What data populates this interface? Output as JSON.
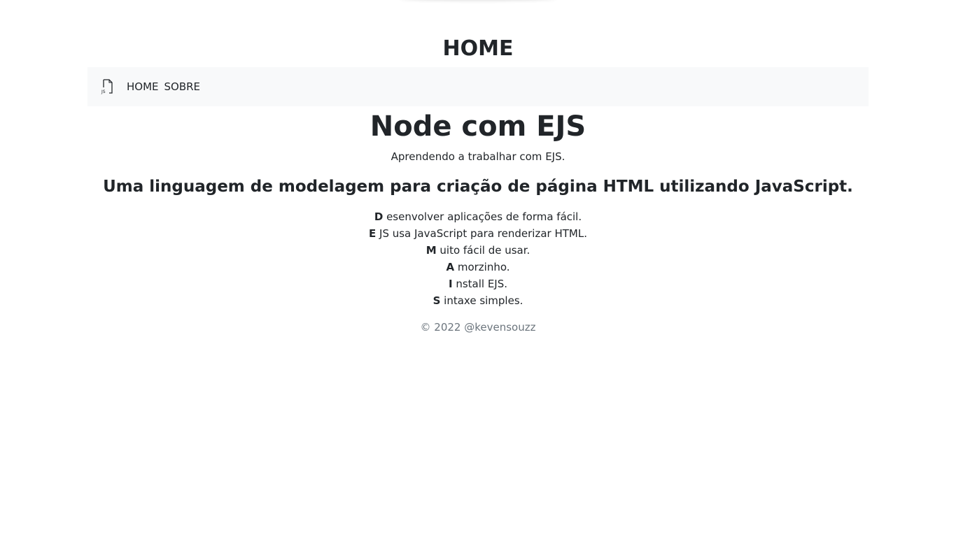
{
  "page": {
    "heading": "HOME"
  },
  "navbar": {
    "brand_icon": "ejs-file-icon",
    "links": [
      {
        "label": "HOME"
      },
      {
        "label": "SOBRE"
      }
    ]
  },
  "main": {
    "title": "Node com EJS",
    "subtitle": "Aprendendo a trabalhar com EJS.",
    "lead": "Uma linguagem de modelagem para criação de página HTML utilizando JavaScript.",
    "acrostic": [
      {
        "letter": "D",
        "rest": " esenvolver aplicações de forma fácil."
      },
      {
        "letter": "E",
        "rest": " JS usa JavaScript para renderizar HTML."
      },
      {
        "letter": "M",
        "rest": " uito fácil de usar."
      },
      {
        "letter": "A",
        "rest": " morzinho."
      },
      {
        "letter": "I",
        "rest": " nstall EJS."
      },
      {
        "letter": "S",
        "rest": " intaxe simples."
      }
    ]
  },
  "footer": {
    "text": "© 2022 @kevensouzz"
  },
  "colors": {
    "text": "#212529",
    "navbar_bg": "#f8f9fa",
    "muted": "#6c757d"
  }
}
